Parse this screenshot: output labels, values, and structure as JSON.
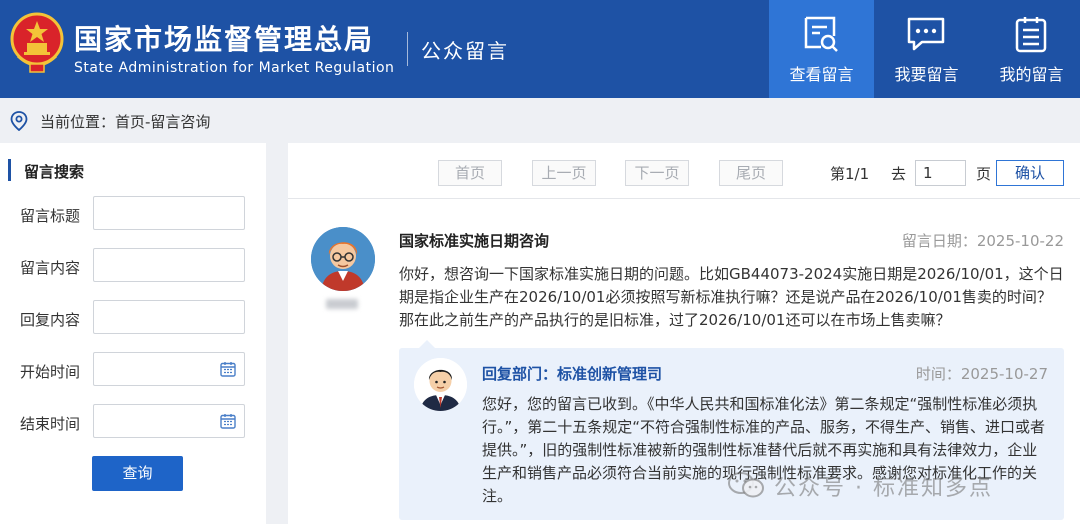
{
  "header": {
    "org_name_cn": "国家市场监督管理总局",
    "org_name_en": "State Administration for Market Regulation",
    "section_title": "公众留言",
    "nav": [
      {
        "label": "查看留言",
        "icon": "view-message-icon",
        "active": true
      },
      {
        "label": "我要留言",
        "icon": "chat-bubble-icon",
        "active": false
      },
      {
        "label": "我的留言",
        "icon": "clipboard-list-icon",
        "active": false
      }
    ]
  },
  "breadcrumb": {
    "text": "当前位置：首页-留言咨询"
  },
  "search": {
    "heading": "留言搜索",
    "fields": [
      {
        "label": "留言标题",
        "value": ""
      },
      {
        "label": "留言内容",
        "value": ""
      },
      {
        "label": "回复内容",
        "value": ""
      },
      {
        "label": "开始时间",
        "value": ""
      },
      {
        "label": "结束时间",
        "value": ""
      }
    ],
    "button": "查询"
  },
  "pager": {
    "first": "首页",
    "prev": "上一页",
    "next": "下一页",
    "last": "尾页",
    "page_info": "第1/1",
    "goto_label": "去",
    "page_input": "1",
    "page_unit": "页",
    "confirm": "确认"
  },
  "message": {
    "title": "国家标准实施日期咨询",
    "date": "留言日期：2025-10-22",
    "body": "你好，想咨询一下国家标准实施日期的问题。比如GB44073-2024实施日期是2026/10/01，这个日期是指企业生产在2026/10/01必须按照写新标准执行嘛？还是说产品在2026/10/01售卖的时间？那在此之前生产的产品执行的是旧标准，过了2026/10/01还可以在市场上售卖嘛？",
    "reply": {
      "department": "回复部门：标准创新管理司",
      "time": "时间：2025-10-27",
      "body": "您好，您的留言已收到。《中华人民共和国标准化法》第二条规定“强制性标准必须执行。”，第二十五条规定“不符合强制性标准的产品、服务，不得生产、销售、进口或者提供。”，旧的强制性标准被新的强制性标准替代后就不再实施和具有法律效力，企业生产和销售产品必须符合当前实施的现行强制性标准要求。感谢您对标准化工作的关注。"
    }
  },
  "watermark": "公众号 · 标准知多点",
  "colors": {
    "header_blue": "#1e52a5",
    "active_nav": "#2f75d6",
    "reply_bg": "#eaf1fb",
    "button_blue": "#1e64c8"
  }
}
